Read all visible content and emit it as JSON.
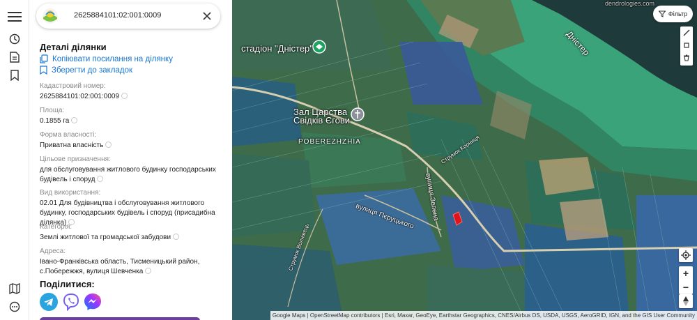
{
  "search": {
    "query": "2625884101:02:001:0009"
  },
  "panel": {
    "title": "Деталі ділянки",
    "copy_link": "Копіювати посилання на ділянку",
    "save_bookmark": "Зберегти до закладок",
    "fields": [
      {
        "label": "Кадастровий номер:",
        "value": "2625884101:02:001:0009"
      },
      {
        "label": "Площа:",
        "value": "0.1855 га"
      },
      {
        "label": "Форма власності:",
        "value": "Приватна власність"
      },
      {
        "label": "Цільове призначення:",
        "value": "для обслуговування житлового будинку господарських будівель і споруд"
      },
      {
        "label": "Вид використання:",
        "value": "02.01 Для будівництва і обслуговування житлового будинку, господарських будівель і споруд (присадибна ділянка)"
      },
      {
        "label": "Категорія:",
        "value": "Землі житлової та громадської забудови"
      },
      {
        "label": "Адреса:",
        "value": "Івано-Франківська область, Тисменицький район, с.Побережжя, вулиця Шевченка"
      }
    ],
    "share_title": "Поділитися:"
  },
  "map": {
    "filter_label": "Фільтр",
    "labels": {
      "stadium": "стадіон \"Дністер\"",
      "kingdom_hall": "Зал Царства Свідків Єгови",
      "village": "POBEREZHZHIA",
      "river": "Дністер",
      "street_zelena": "вулиця Зелена",
      "street_pierutskoho": "вулиця Пєруцького",
      "stream_1": "Струмок Корниця",
      "stream_2": "Струмок Волнівець",
      "watermark": "dendrologies.com"
    },
    "attribution": "Google Maps | OpenStreetMap contributors | Esri, Maxar, GeoEye, Earthstar Geographics, CNES/Airbus DS, USDA, USGS, AeroGRID, IGN, and the GIS User Community"
  },
  "colors": {
    "accent": "#1976d2",
    "parcel_highlight": "#e0151b",
    "river": "#1f3a3a",
    "floodplain": "#3aa37a"
  },
  "icons": {
    "rail": [
      "menu-icon",
      "history-icon",
      "document-icon",
      "bookmark-icon",
      "map-book-icon",
      "chat-icon"
    ],
    "share": [
      "telegram-icon",
      "viber-icon",
      "messenger-icon"
    ]
  }
}
